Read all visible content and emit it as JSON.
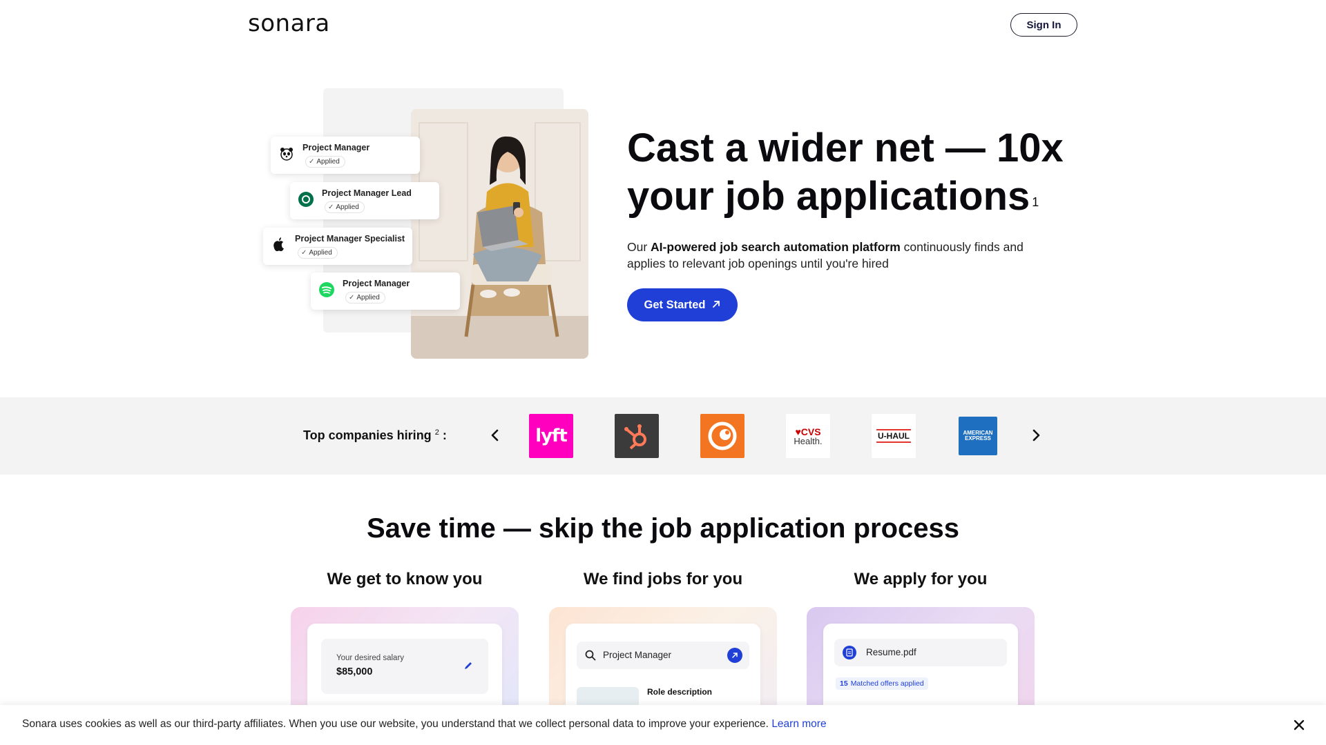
{
  "header": {
    "logo_text": "sonara",
    "signin_label": "Sign In"
  },
  "hero": {
    "job_cards": [
      {
        "title": "Project Manager",
        "status": "Applied",
        "company_icon": "panda-icon"
      },
      {
        "title": "Project Manager Lead",
        "status": "Applied",
        "company_icon": "starbucks-icon"
      },
      {
        "title": "Project Manager Specialist",
        "status": "Applied",
        "company_icon": "apple-icon"
      },
      {
        "title": "Project Manager",
        "status": "Applied",
        "company_icon": "spotify-icon"
      }
    ],
    "title_line1": "Cast a wider net — 10x",
    "title_line2": "your job applications",
    "title_footnote": "1",
    "sub_lead": "Our ",
    "sub_bold": "AI-powered job search automation platform",
    "sub_rest": " continuously finds and applies to relevant job openings until you're hired",
    "cta_label": "Get Started",
    "cta_icon": "arrow-up-right-icon"
  },
  "companies": {
    "label": "Top companies hiring",
    "footnote": "2",
    "colon": ":",
    "logos": [
      {
        "name": "lyft",
        "bg": "#ff00bf",
        "text": "lyft"
      },
      {
        "name": "hubspot",
        "bg": "#33475b",
        "text": ""
      },
      {
        "name": "crunchyroll",
        "bg": "#f47521",
        "text": ""
      },
      {
        "name": "cvs-health",
        "bg": "#ffffff",
        "text1": "♥CVS",
        "text2": "Health."
      },
      {
        "name": "uhaul",
        "bg": "#ffffff",
        "text": "U-HAUL"
      },
      {
        "name": "american-express",
        "bg": "#1f6fc0",
        "text1": "AMERICAN",
        "text2": "EXPRESS"
      }
    ]
  },
  "section": {
    "title": "Save time — skip the job application process",
    "columns": [
      {
        "title": "We get to know you"
      },
      {
        "title": "We find jobs for you"
      },
      {
        "title": "We apply for you"
      }
    ],
    "card1": {
      "salary_label": "Your desired salary",
      "salary_value": "$85,000"
    },
    "card2": {
      "search_value": "Project Manager",
      "role_label": "Role description"
    },
    "card3": {
      "file_name": "Resume.pdf",
      "matched_count": "15",
      "matched_label": "Matched offers applied"
    }
  },
  "cookie": {
    "text": "Sonara uses cookies as well as our third-party affiliates. When you use our website, you understand that we collect personal data to improve your experience.",
    "link": "Learn more"
  },
  "colors": {
    "accent": "#1f3fd6",
    "strip_bg": "#f3f3f3"
  }
}
